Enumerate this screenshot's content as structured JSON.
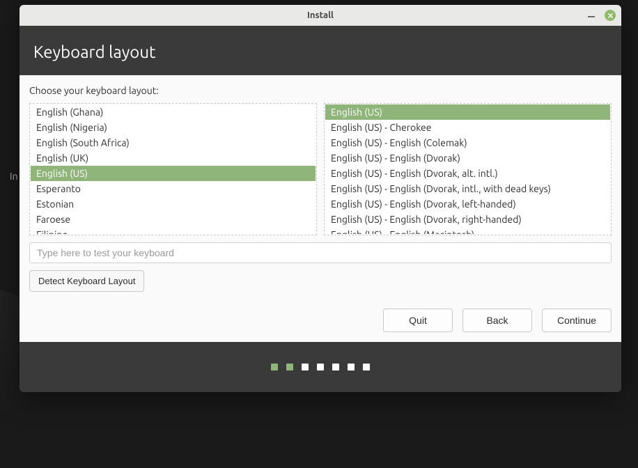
{
  "bg_label": "In",
  "window": {
    "title": "Install"
  },
  "header": {
    "title": "Keyboard layout"
  },
  "body": {
    "prompt": "Choose your keyboard layout:",
    "left_list": [
      {
        "label": "English (Ghana)",
        "selected": false
      },
      {
        "label": "English (Nigeria)",
        "selected": false
      },
      {
        "label": "English (South Africa)",
        "selected": false
      },
      {
        "label": "English (UK)",
        "selected": false
      },
      {
        "label": "English (US)",
        "selected": true
      },
      {
        "label": "Esperanto",
        "selected": false
      },
      {
        "label": "Estonian",
        "selected": false
      },
      {
        "label": "Faroese",
        "selected": false
      },
      {
        "label": "Filipino",
        "selected": false
      }
    ],
    "right_list": [
      {
        "label": "English (US)",
        "selected": true
      },
      {
        "label": "English (US) - Cherokee",
        "selected": false
      },
      {
        "label": "English (US) - English (Colemak)",
        "selected": false
      },
      {
        "label": "English (US) - English (Dvorak)",
        "selected": false
      },
      {
        "label": "English (US) - English (Dvorak, alt. intl.)",
        "selected": false
      },
      {
        "label": "English (US) - English (Dvorak, intl., with dead keys)",
        "selected": false
      },
      {
        "label": "English (US) - English (Dvorak, left-handed)",
        "selected": false
      },
      {
        "label": "English (US) - English (Dvorak, right-handed)",
        "selected": false
      },
      {
        "label": "English (US) - English (Macintosh)",
        "selected": false
      }
    ],
    "test_placeholder": "Type here to test your keyboard",
    "detect_label": "Detect Keyboard Layout"
  },
  "actions": {
    "quit": "Quit",
    "back": "Back",
    "continue": "Continue"
  },
  "progress": {
    "total": 7,
    "completed": 2
  }
}
